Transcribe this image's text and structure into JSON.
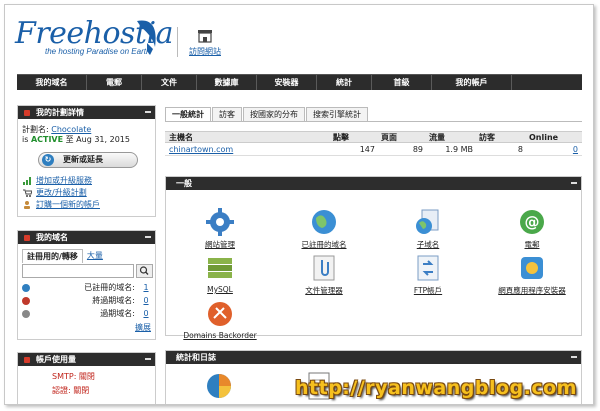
{
  "header": {
    "logo_text": "Freehostia",
    "logo_subtitle": "the hosting Paradise on Earth",
    "visitor_link": "訪問網站"
  },
  "nav": [
    {
      "label": "我的域名",
      "w": 70
    },
    {
      "label": "電郵",
      "w": 55
    },
    {
      "label": "文件",
      "w": 55
    },
    {
      "label": "數據庫",
      "w": 60
    },
    {
      "label": "安裝器",
      "w": 60
    },
    {
      "label": "統計",
      "w": 55
    },
    {
      "label": "首級",
      "w": 60
    },
    {
      "label": "我的帳戶",
      "w": 80
    }
  ],
  "plan": {
    "title": "我的計劃詳情",
    "plan_label": "計劃名:",
    "plan_name": "Chocolate",
    "is_label": "is",
    "status": "ACTIVE",
    "until": "至 Aug 31, 2015",
    "renew_button": "更新或延長",
    "links": [
      "增加或升級服務",
      "更改/升級計劃",
      "訂購一個新的帳戶"
    ]
  },
  "domains": {
    "title": "我的域名",
    "tab_active": "註冊用的/轉移",
    "tab_other": "大量",
    "rows": [
      {
        "label": "已註冊的域名:",
        "count": "1",
        "color": "#2f7fc0"
      },
      {
        "label": "將過期域名:",
        "count": "0",
        "color": "#c0392b"
      },
      {
        "label": "過期域名:",
        "count": "0",
        "color": "#888888"
      }
    ],
    "more": "擴展"
  },
  "usage": {
    "title": "帳戶使用量",
    "rows": [
      "SMTP: 關閉",
      "認證: 關閉"
    ]
  },
  "main_tabs": [
    "一般統計",
    "訪客",
    "按國家的分布",
    "搜索引擎統計"
  ],
  "table": {
    "headers": [
      "主機名",
      "點擊",
      "頁面",
      "流量",
      "訪客",
      "Online"
    ],
    "rows": [
      [
        "chinartown.com",
        "147",
        "89",
        "1.9 MB",
        "8",
        "0"
      ]
    ]
  },
  "general": {
    "title": "一般",
    "tools": [
      {
        "label": "網站管理",
        "icon": "gear-icon"
      },
      {
        "label": "已註冊的域名",
        "icon": "globe-icon"
      },
      {
        "label": "子域名",
        "icon": "subdomain-icon"
      },
      {
        "label": "電郵",
        "icon": "at-icon"
      },
      {
        "label": "MySQL",
        "icon": "database-icon"
      },
      {
        "label": "文件管理器",
        "icon": "paperclip-icon"
      },
      {
        "label": "FTP帳戶",
        "icon": "ftp-icon"
      },
      {
        "label": "網頁應用程序安裝器",
        "icon": "installer-icon"
      },
      {
        "label": "Domains Backorder",
        "icon": "backorder-icon"
      }
    ]
  },
  "stats": {
    "title": "統計和日誌"
  },
  "watermark": "http://ryanwangblog.com",
  "colors": {
    "nav_bg": "#2c2c2c",
    "link": "#1a5fa8",
    "active": "#1f8e2c",
    "alert": "#c0231a"
  }
}
